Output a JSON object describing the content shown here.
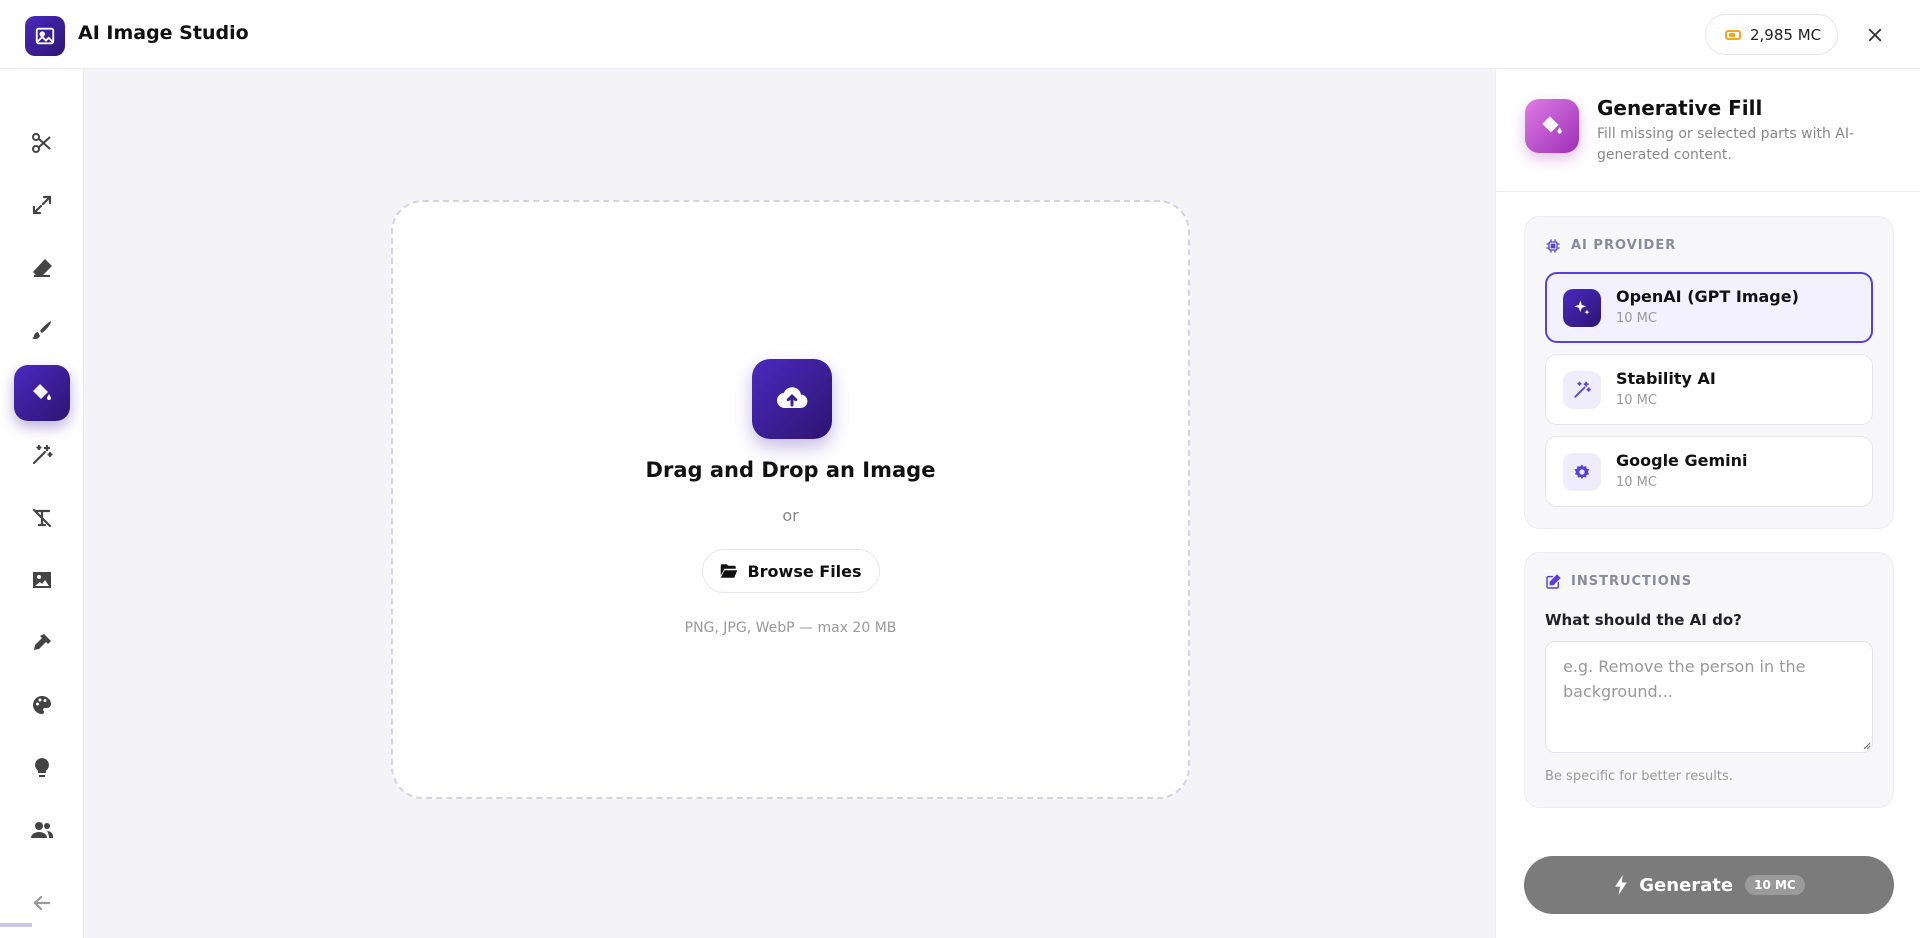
{
  "header": {
    "title": "AI Image Studio",
    "credits": "2,985 MC",
    "icons": {
      "logo": "image-icon",
      "credits": "coin-icon",
      "close": "close-icon"
    }
  },
  "sidebar": {
    "tools": [
      {
        "icon": "scissors-icon",
        "active": false
      },
      {
        "icon": "expand-icon",
        "active": false
      },
      {
        "icon": "eraser-icon",
        "active": false
      },
      {
        "icon": "brush-icon",
        "active": false
      },
      {
        "icon": "paint-bucket-icon",
        "active": true
      },
      {
        "icon": "magic-wand-icon",
        "active": false
      },
      {
        "icon": "remove-text-icon",
        "active": false
      },
      {
        "icon": "image-icon",
        "active": false
      },
      {
        "icon": "pen-nib-icon",
        "active": false
      },
      {
        "icon": "palette-icon",
        "active": false
      },
      {
        "icon": "lightbulb-icon",
        "active": false
      },
      {
        "icon": "users-icon",
        "active": false
      }
    ],
    "back_icon": "arrow-left-icon"
  },
  "dropzone": {
    "title": "Drag and Drop an Image",
    "or": "or",
    "browse_label": "Browse Files",
    "hint": "PNG, JPG, WebP — max 20 MB",
    "icons": {
      "upload": "cloud-upload-icon",
      "browse": "folder-open-icon"
    }
  },
  "panel": {
    "title": "Generative Fill",
    "subtitle": "Fill missing or selected parts with AI-generated content.",
    "icon": "paint-bucket-icon",
    "providers_label": "AI PROVIDER",
    "providers": [
      {
        "name": "OpenAI (GPT Image)",
        "cost": "10 MC",
        "icon": "sparkles-icon",
        "selected": true
      },
      {
        "name": "Stability AI",
        "cost": "10 MC",
        "icon": "magic-wand-icon",
        "selected": false
      },
      {
        "name": "Google Gemini",
        "cost": "10 MC",
        "icon": "gear-icon",
        "selected": false
      }
    ],
    "instructions_label": "INSTRUCTIONS",
    "question": "What should the AI do?",
    "placeholder": "e.g. Remove the person in the background...",
    "hint": "Be specific for better results.",
    "generate_label": "Generate",
    "generate_cost": "10 MC"
  },
  "colors": {
    "accent": "#4a2ac0",
    "accent_dark": "#2d1470",
    "fill_icon": "#c057d0",
    "generate_disabled": "#7b7b7b",
    "credit_coin": "#f2a818"
  }
}
